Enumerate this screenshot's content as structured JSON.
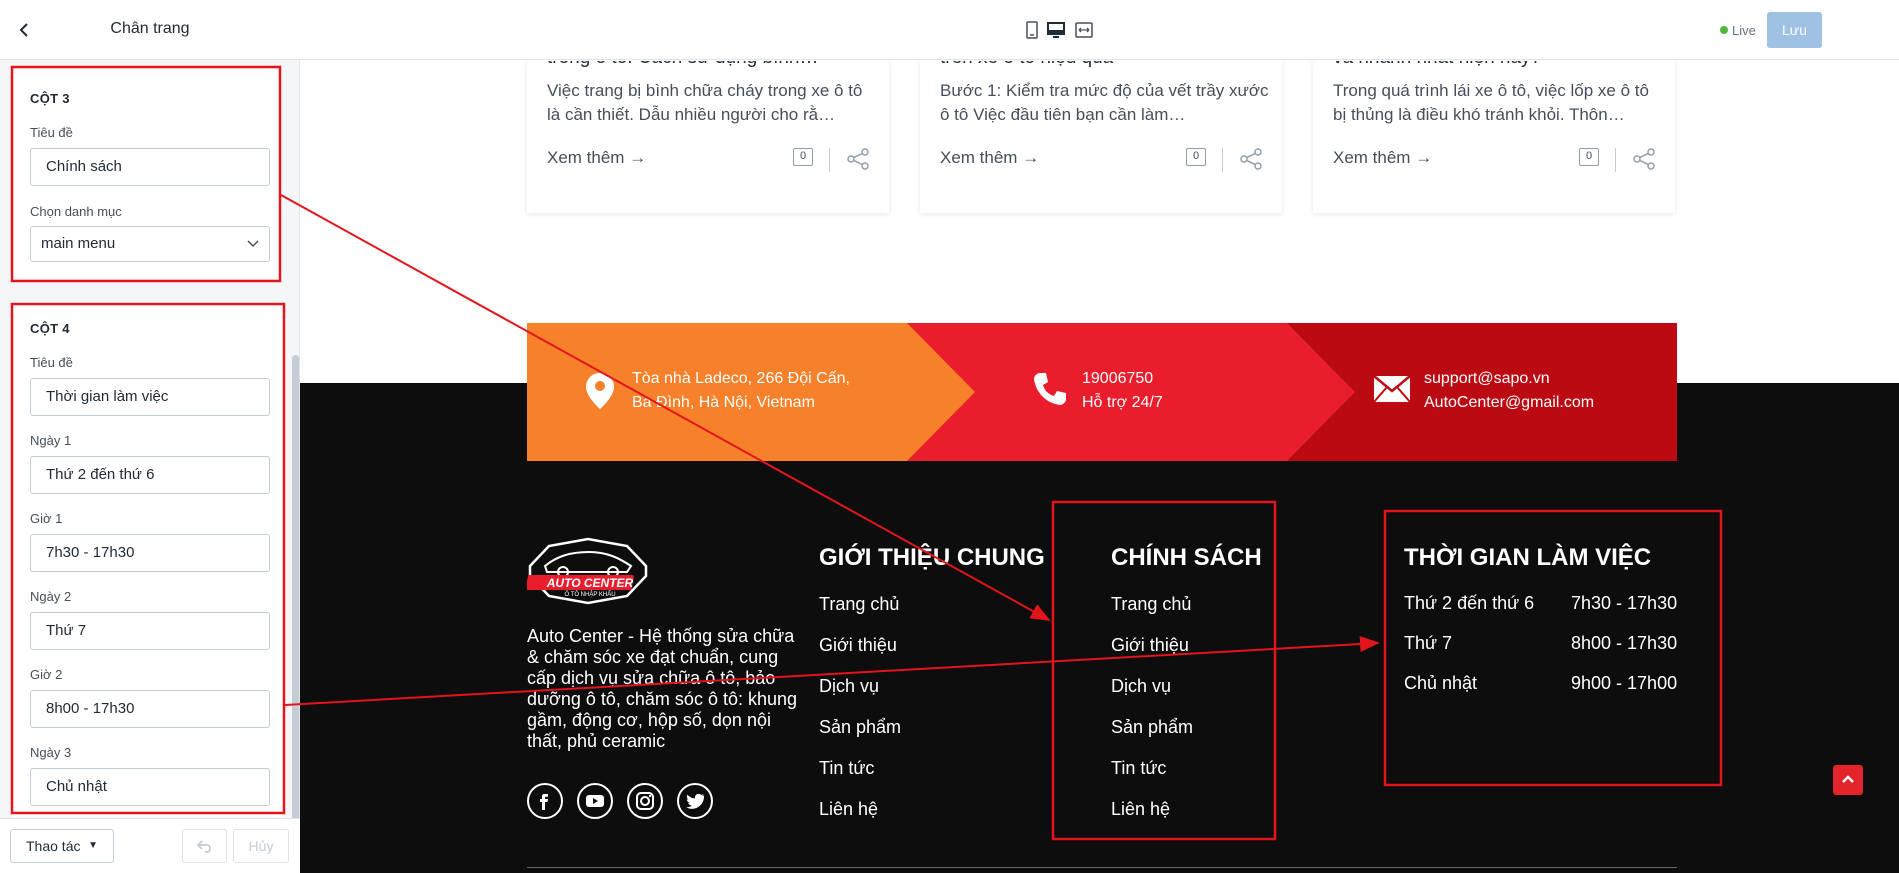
{
  "sidebar": {
    "title": "Chân trang",
    "col3": {
      "heading": "CỘT 3",
      "title_label": "Tiêu đề",
      "title_value": "Chính sách",
      "menu_label": "Chọn danh mục",
      "menu_value": "main menu"
    },
    "col4": {
      "heading": "CỘT 4",
      "title_label": "Tiêu đề",
      "title_value": "Thời gian làm việc",
      "day1_label": "Ngày 1",
      "day1_value": "Thứ 2 đến thứ 6",
      "time1_label": "Giờ 1",
      "time1_value": "7h30 - 17h30",
      "day2_label": "Ngày 2",
      "day2_value": "Thứ 7",
      "time2_label": "Giờ 2",
      "time2_value": "8h00 - 17h30",
      "day3_label": "Ngày 3",
      "day3_value": "Chủ nhật"
    },
    "footer": {
      "actions_label": "Thao tác",
      "cancel_label": "Hủy"
    }
  },
  "topbar": {
    "live_label": "Live",
    "save_label": "Lưu"
  },
  "blogs": [
    {
      "title": "trong ô tô: Cách sử dụng bình…",
      "excerpt": "Việc trang bị bình chữa cháy trong xe ô tô là cần thiết. Dẫu nhiều người cho rằ…",
      "read_more": "Xem thêm →",
      "comments": "0"
    },
    {
      "title": "trên xe ô tô hiệu quả",
      "excerpt": "Bước 1: Kiểm tra mức độ của vết trầy xước ô tô Việc đầu tiên bạn cần làm…",
      "read_more": "Xem thêm →",
      "comments": "0"
    },
    {
      "title": "và nhanh nhất hiện nay?",
      "excerpt": "Trong quá trình lái xe ô tô, việc lốp xe ô tô bị thủng là điều khó tránh khỏi. Thôn…",
      "read_more": "Xem thêm →",
      "comments": "0"
    }
  ],
  "contact": {
    "address_line1": "Tòa nhà Ladeco, 266 Đội Cấn,",
    "address_line2": "Ba Đình, Hà Nội, Vietnam",
    "phone_line1": "19006750",
    "phone_line2": "Hỗ trợ 24/7",
    "email_line1": "support@sapo.vn",
    "email_line2": "AutoCenter@gmail.com",
    "colors": {
      "orange": "#f7812a",
      "red": "#ea1d2c",
      "dark_red": "#bb0a12"
    }
  },
  "footer": {
    "logo_text": "AUTO CENTER",
    "logo_sub": "Ô TÔ NHẬP KHẨU",
    "about": "Auto Center - Hệ thống sửa chữa & chăm sóc xe đạt chuẩn, cung cấp dịch vụ sửa chữa ô tô, bảo dưỡng ô tô, chăm sóc ô tô: khung gầm, động cơ, hộp số, dọn nội thất, phủ ceramic",
    "col2": {
      "heading": "GIỚI THIỆU CHUNG",
      "links": [
        "Trang chủ",
        "Giới thiệu",
        "Dịch vụ",
        "Sản phẩm",
        "Tin tức",
        "Liên hệ"
      ]
    },
    "col3": {
      "heading": "CHÍNH SÁCH",
      "links": [
        "Trang chủ",
        "Giới thiệu",
        "Dịch vụ",
        "Sản phẩm",
        "Tin tức",
        "Liên hệ"
      ]
    },
    "col4": {
      "heading": "THỜI GIAN LÀM VIỆC",
      "rows": [
        {
          "day": "Thứ 2 đến thứ 6",
          "time": "7h30 - 17h30"
        },
        {
          "day": "Thứ 7",
          "time": "8h00 - 17h30"
        },
        {
          "day": "Chủ nhật",
          "time": "9h00 - 17h00"
        }
      ]
    },
    "socials": [
      "facebook-icon",
      "youtube-icon",
      "instagram-icon",
      "twitter-icon"
    ]
  },
  "annotation_color": "#e3141b"
}
